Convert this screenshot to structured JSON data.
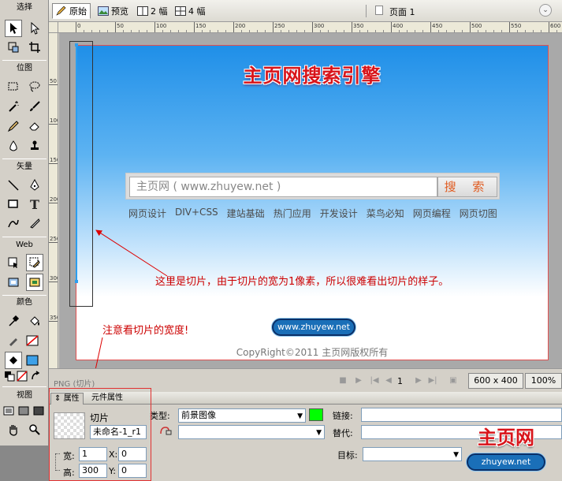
{
  "tools": {
    "select_label": "选择",
    "bitmap_label": "位图",
    "vector_label": "矢量",
    "web_label": "Web",
    "colors_label": "颜色",
    "view_label": "视图"
  },
  "doc_toolbar": {
    "tab_original": "原始",
    "tab_preview": "预览",
    "tab_2up": "2 幅",
    "tab_4up": "4 幅",
    "page_label": "页面 1"
  },
  "rulers": {
    "top": [
      "0",
      "50",
      "100",
      "150",
      "200",
      "250",
      "300",
      "350",
      "400",
      "450",
      "500",
      "550",
      "600"
    ],
    "left": [
      "50",
      "100",
      "150",
      "200",
      "250",
      "300",
      "350"
    ]
  },
  "canvas": {
    "logo": "主页网搜索引擎",
    "search_placeholder": "主页网 ( www.zhuyew.net )",
    "search_button": "搜 索",
    "nav_links": [
      "网页设计",
      "DIV+CSS",
      "建站基础",
      "热门应用",
      "开发设计",
      "菜鸟必知",
      "网页编程",
      "网页切图"
    ],
    "url_badge": "www.zhuyew.net",
    "copyright": "CopyRight©2011 主页网版权所有"
  },
  "annotations": {
    "slice_note": "这里是切片，由于切片的宽为1像素，所以很难看出切片的样子。",
    "width_note": "注意看切片的宽度!"
  },
  "statusbar": {
    "label": "PNG (切片)",
    "frame": "1",
    "size": "600 x 400",
    "zoom": "100%"
  },
  "props": {
    "tab_properties": "属性",
    "tab_symbol": "元件属性",
    "object_type": "切片",
    "object_name": "未命名-1_r1",
    "width_label": "宽:",
    "width_value": "1",
    "height_label": "高:",
    "height_value": "300",
    "x_label": "X:",
    "x_value": "0",
    "y_label": "Y:",
    "y_value": "0",
    "type_label": "类型:",
    "type_value": "前景图像",
    "link_label": "链接:",
    "alt_label": "替代:",
    "target_label": "目标:"
  },
  "watermark": {
    "title": "主页网",
    "url": "zhuyew.net"
  },
  "colors": {
    "slice_fill": "#00ff00",
    "annotation": "#cc0000"
  }
}
